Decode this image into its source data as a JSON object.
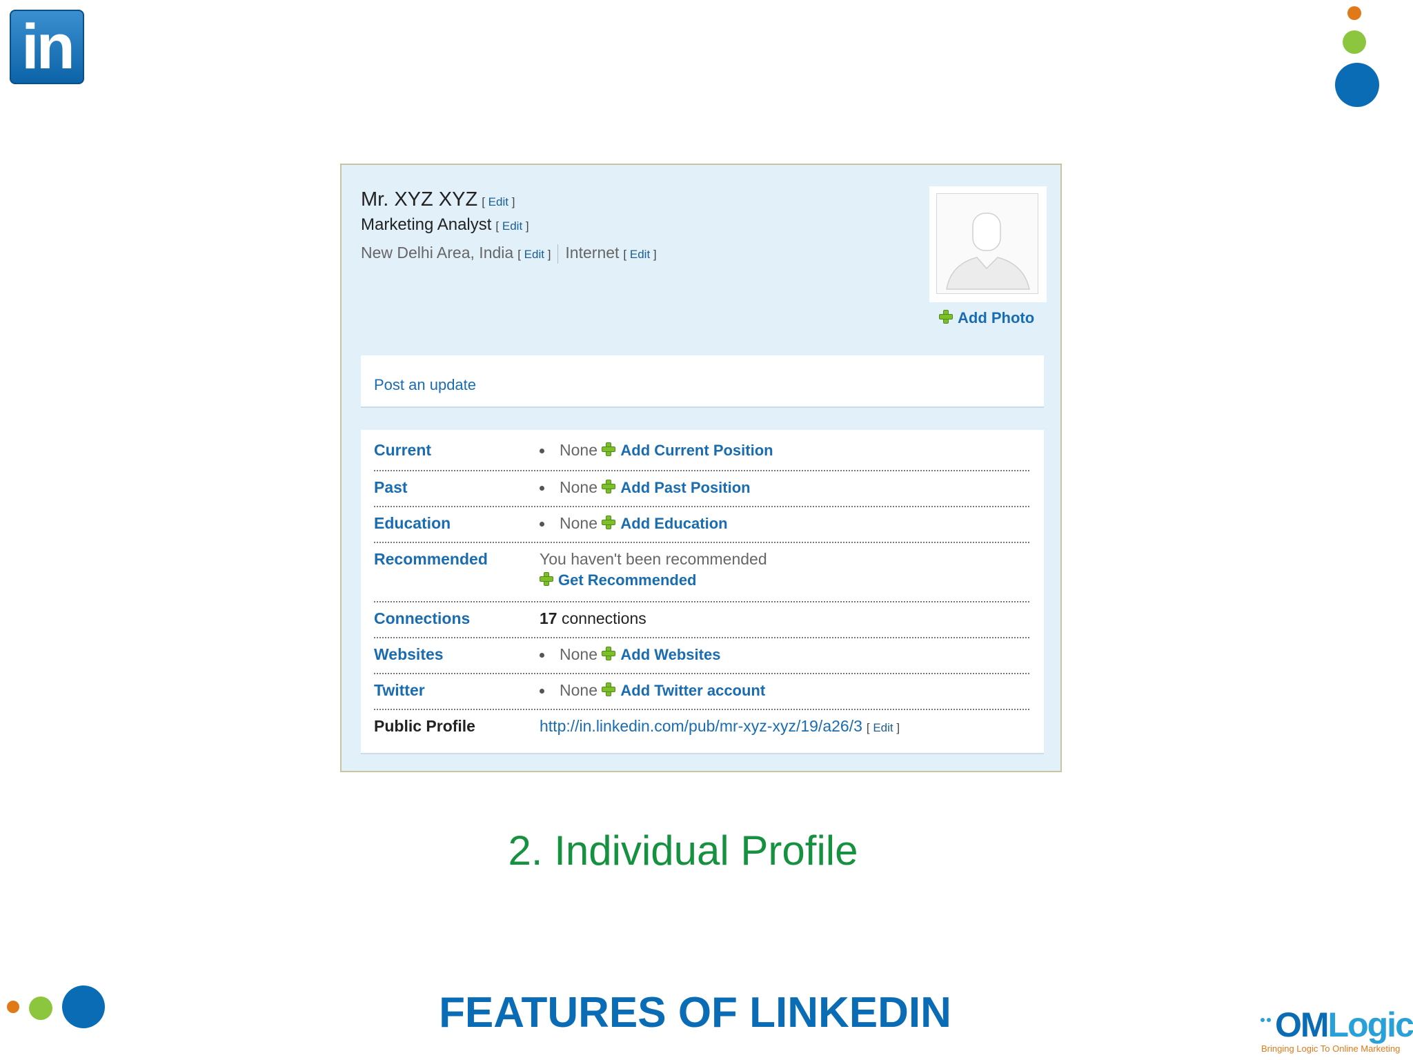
{
  "logo": {
    "text": "in"
  },
  "profile": {
    "name": "Mr. XYZ XYZ",
    "headline": "Marketing Analyst",
    "location": "New Delhi Area, India",
    "industry": "Internet",
    "edit_open": "[",
    "edit_label": "Edit",
    "edit_close": "]",
    "add_photo_label": "Add Photo"
  },
  "post_update": {
    "label": "Post an update"
  },
  "rows": {
    "current": {
      "label": "Current",
      "none": "None",
      "action": "Add Current Position"
    },
    "past": {
      "label": "Past",
      "none": "None",
      "action": "Add Past Position"
    },
    "education": {
      "label": "Education",
      "none": "None",
      "action": "Add Education"
    },
    "recommended": {
      "label": "Recommended",
      "text": "You haven't been recommended",
      "action": "Get Recommended"
    },
    "connections": {
      "label": "Connections",
      "count": "17",
      "unit": "connections"
    },
    "websites": {
      "label": "Websites",
      "none": "None",
      "action": "Add Websites"
    },
    "twitter": {
      "label": "Twitter",
      "none": "None",
      "action": "Add Twitter account"
    },
    "public_profile": {
      "label": "Public Profile",
      "url": "http://in.linkedin.com/pub/mr-xyz-xyz/19/a26/3"
    }
  },
  "slide": {
    "subtitle": "2. Individual Profile",
    "title": "FEATURES OF LINKEDIN"
  },
  "brand": {
    "name_part1": "OM",
    "name_part2": "Logic",
    "tagline": "Bringing Logic To Online Marketing"
  },
  "colors": {
    "linkedin_blue": "#0c63a7",
    "accent_green": "#169140",
    "title_blue": "#0a6cb5",
    "dot_orange": "#e07a18",
    "dot_green": "#8cc63f",
    "dot_blue": "#0a6cb5"
  },
  "icons": [
    "linkedin-logo-icon",
    "plus-icon",
    "avatar-placeholder-icon",
    "decorative-dots-icon"
  ]
}
